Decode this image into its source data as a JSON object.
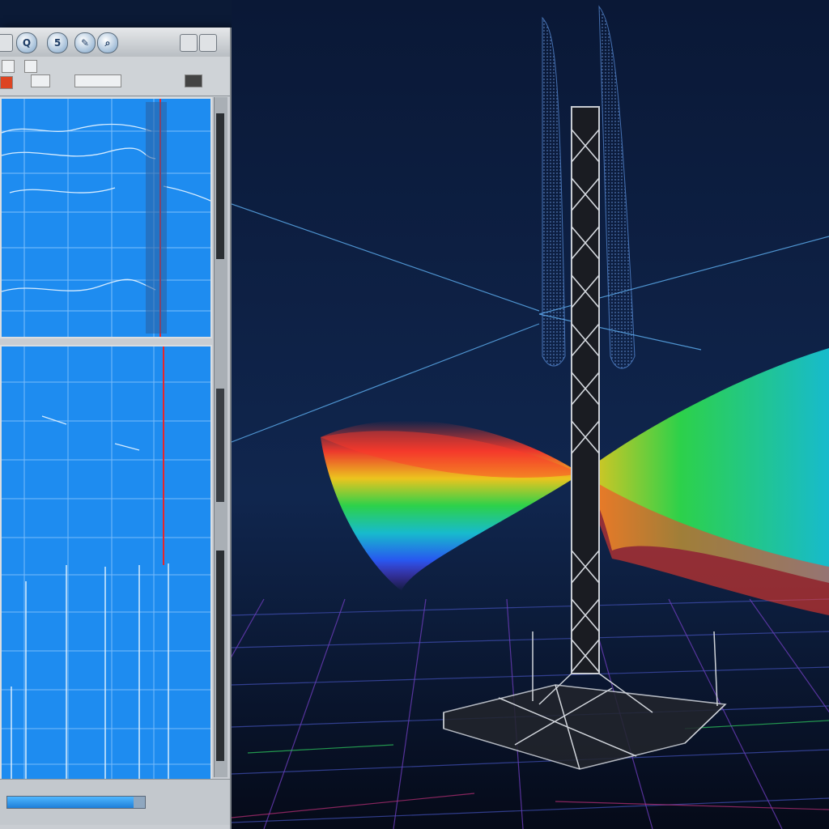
{
  "toolbar": {
    "buttons": [
      {
        "icon": "find-icon",
        "glyph": "Q"
      },
      {
        "icon": "refresh-icon",
        "glyph": "5"
      },
      {
        "icon": "record-icon",
        "glyph": "✎"
      },
      {
        "icon": "search-icon",
        "glyph": "⌕"
      }
    ]
  },
  "colors": {
    "plot_bg": "#1e8cf0",
    "scene_bg": "#0b1a36",
    "trace": "#cde6ff",
    "marker": "#e8262b"
  }
}
